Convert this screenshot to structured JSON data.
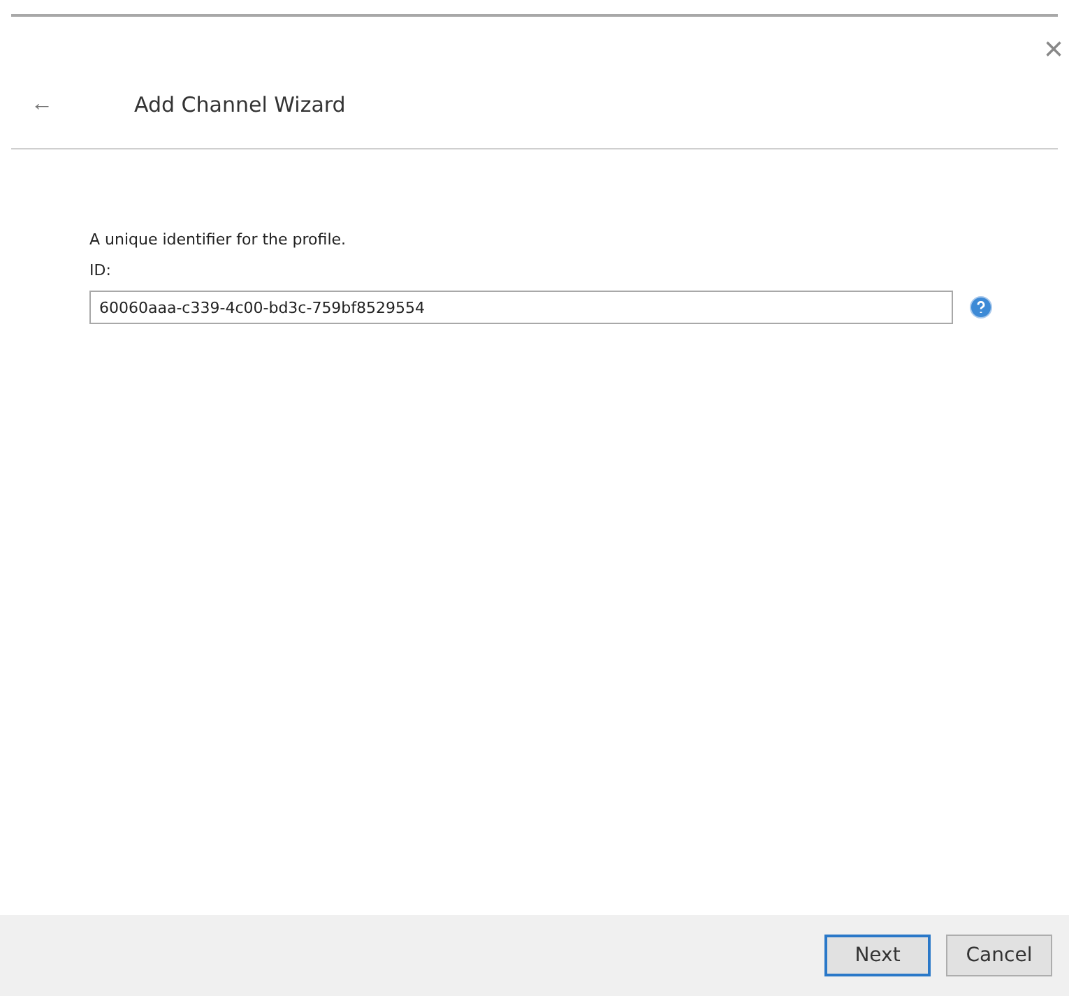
{
  "close_button": {
    "glyph": "×"
  },
  "header": {
    "back": "←",
    "title": "Add Channel Wizard"
  },
  "form": {
    "description": "A unique identifier for the profile.",
    "label": "ID:",
    "value": "60060aaa-c339-4c00-bd3c-759bf8529554"
  },
  "buttons": [
    {
      "label": "Next",
      "default": true
    },
    {
      "label": "Cancel",
      "default": false
    }
  ]
}
